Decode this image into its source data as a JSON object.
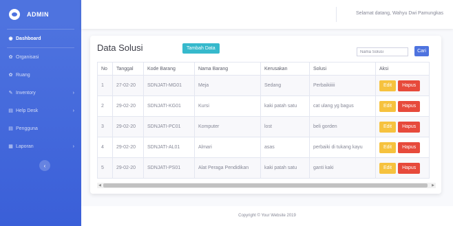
{
  "sidebar": {
    "brand": "ADMIN",
    "items": [
      {
        "label": "Dashboard",
        "icon": "dashboard-icon",
        "active": true,
        "has_arrow": false
      },
      {
        "label": "Organisasi",
        "icon": "gear-icon",
        "active": false,
        "has_arrow": false
      },
      {
        "label": "Ruang",
        "icon": "gear-icon",
        "active": false,
        "has_arrow": false
      },
      {
        "label": "Inventory",
        "icon": "wrench-icon",
        "active": false,
        "has_arrow": true
      },
      {
        "label": "Help Desk",
        "icon": "table-icon",
        "active": false,
        "has_arrow": true
      },
      {
        "label": "Pengguna",
        "icon": "table-icon",
        "active": false,
        "has_arrow": false
      },
      {
        "label": "Laporan",
        "icon": "calendar-icon",
        "active": false,
        "has_arrow": true
      }
    ]
  },
  "topbar": {
    "welcome": "Selamat datang, Wahyu Dwi Pamungkas"
  },
  "main": {
    "title": "Data Solusi",
    "add_button": "Tambah Data",
    "search_placeholder": "Nama Solusi",
    "search_button": "Cari",
    "columns": [
      "No",
      "Tanggal",
      "Kode Barang",
      "Nama Barang",
      "Kerusakan",
      "Solusi",
      "Aksi"
    ],
    "rows": [
      [
        "1",
        "27-02-20",
        "SDNJATI-MG01",
        "Meja",
        "Sedang",
        "Perbaikiiiii"
      ],
      [
        "2",
        "29-02-20",
        "SDNJATI-KG01",
        "Kursi",
        "kaki patah satu",
        "cat ulang yg bagus"
      ],
      [
        "3",
        "29-02-20",
        "SDNJATI-PC01",
        "Komputer",
        "lost",
        "beli gorden"
      ],
      [
        "4",
        "29-02-20",
        "SDNJATI-AL01",
        "Almari",
        "asas",
        "perbaiki di tukang kayu"
      ],
      [
        "5",
        "29-02-20",
        "SDNJATI-PS01",
        "Alat Peraga Pendidikan",
        "kaki patah satu",
        "ganti kaki"
      ]
    ],
    "edit_label": "Edit",
    "delete_label": "Hapus"
  },
  "footer": {
    "copyright": "Copyright © Your Website 2019"
  },
  "colors": {
    "primary": "#4e73df",
    "info": "#36b9cc",
    "warning": "#f6c23e",
    "danger": "#e74a3b"
  }
}
